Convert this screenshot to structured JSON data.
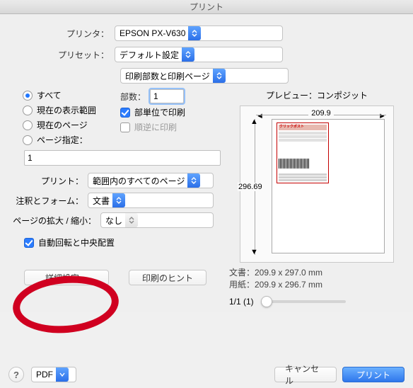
{
  "window": {
    "title": "プリント"
  },
  "printer": {
    "label": "プリンタ：",
    "value": "EPSON PX-V630"
  },
  "preset": {
    "label": "プリセット：",
    "value": "デフォルト設定"
  },
  "section_select": {
    "value": "印刷部数と印刷ページ"
  },
  "page_scope": {
    "all": "すべて",
    "current_view": "現在の表示範囲",
    "current_page": "現在のページ",
    "range": "ページ指定：",
    "range_value": "1"
  },
  "copies": {
    "label": "部数：",
    "value": "1",
    "collate": "部単位で印刷",
    "reverse": "順逆に印刷"
  },
  "print_select": {
    "label": "プリント：",
    "value": "範囲内のすべてのページ"
  },
  "annot_form": {
    "label": "注釈とフォーム：",
    "value": "文書"
  },
  "scale": {
    "label": "ページの拡大 / 縮小：",
    "value": "なし"
  },
  "auto_rotate": "自動回転と中央配置",
  "buttons": {
    "advanced": "詳細設定…",
    "hint": "印刷のヒント",
    "pdf": "PDF",
    "cancel": "キャンセル",
    "print": "プリント"
  },
  "preview": {
    "title": "プレビュー：コンポジット",
    "width": "209.9",
    "height": "296.69",
    "label_brand": "クリックポスト",
    "doc_info": "文書：209.9 x 297.0 mm",
    "paper_info": "用紙：209.9 x 296.7 mm",
    "pager": "1/1 (1)"
  }
}
